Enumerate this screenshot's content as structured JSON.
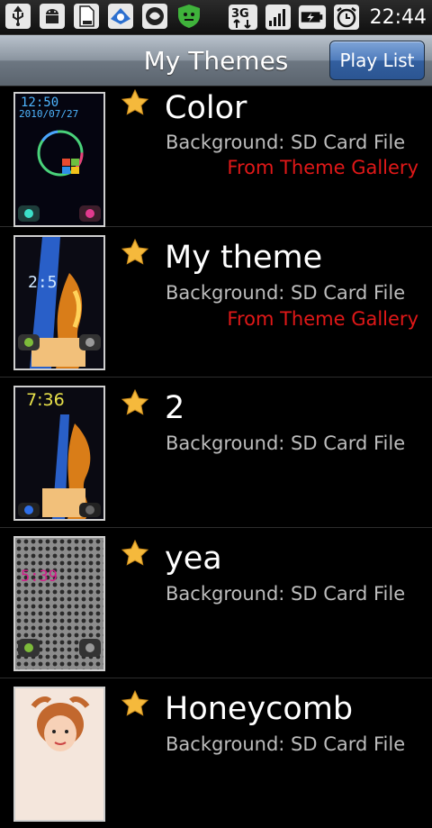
{
  "status_bar": {
    "network": "3G",
    "time": "22:44",
    "icons": [
      "usb-icon",
      "android-debug-icon",
      "sd-card-icon",
      "app-notification-icon",
      "app-notification-icon",
      "app-notification-icon",
      "network-3g-icon",
      "signal-icon",
      "battery-icon",
      "alarm-icon"
    ]
  },
  "header": {
    "title": "My Themes",
    "play_list_label": "Play List"
  },
  "themes": [
    {
      "name": "Color",
      "background": "Background: SD Card File",
      "source": "From Theme Gallery",
      "favorite_icon": "star-icon"
    },
    {
      "name": "My theme",
      "background": "Background: SD Card File",
      "source": "From Theme Gallery",
      "favorite_icon": "star-icon"
    },
    {
      "name": "2",
      "background": "Background: SD Card File",
      "favorite_icon": "star-icon"
    },
    {
      "name": "yea",
      "background": "Background: SD Card File",
      "favorite_icon": "star-icon"
    },
    {
      "name": "Honeycomb",
      "background": "Background: SD Card File",
      "favorite_icon": "star-icon"
    }
  ],
  "colors": {
    "source_text": "#e01818",
    "secondary_text": "#bdbdbd",
    "star": "#f5b93c"
  }
}
